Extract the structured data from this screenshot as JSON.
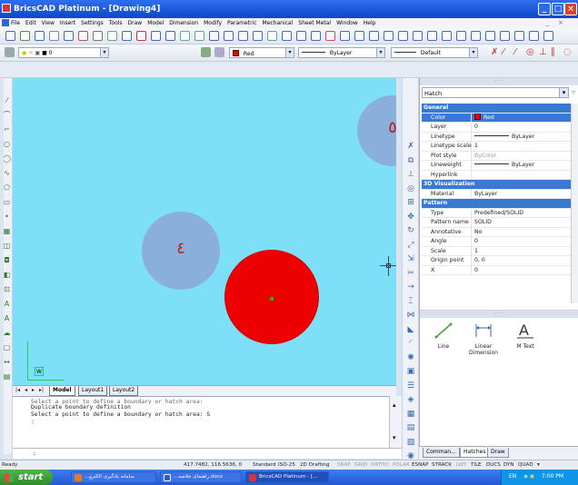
{
  "window": {
    "title": "BricsCAD Platinum - [Drawing4]",
    "btn_min": "_",
    "btn_max": "□",
    "btn_close": "×"
  },
  "menu": [
    "File",
    "Edit",
    "View",
    "Insert",
    "Settings",
    "Tools",
    "Draw",
    "Model",
    "Dimension",
    "Modify",
    "Parametric",
    "Mechanical",
    "Sheet Metal",
    "Window",
    "Help"
  ],
  "layer_toolbar": {
    "layer_value": "0",
    "color_value": "Red",
    "linetype_value": "ByLayer",
    "lineweight_value": "Default"
  },
  "viewport": {
    "annotation_1": "٥",
    "annotation_2": "٤",
    "ucs_label": "W"
  },
  "layout_tabs": [
    "Model",
    "Layout1",
    "Layout2"
  ],
  "command": {
    "lines": [
      "Select a point to define a boundary or hatch area:",
      "Duplicate boundary definition",
      "Select a point to define a boundary or hatch area: S",
      ":"
    ],
    "prompt": ":"
  },
  "properties": {
    "selector": "Hatch",
    "rows": [
      {
        "type": "cat",
        "label": "General"
      },
      {
        "type": "row",
        "key": "Color",
        "value": "Red",
        "hl": true,
        "swatch": true
      },
      {
        "type": "row",
        "key": "Layer",
        "value": "0"
      },
      {
        "type": "row",
        "key": "Linetype",
        "value": "ByLayer",
        "line": true
      },
      {
        "type": "row",
        "key": "Linetype scale",
        "value": "1"
      },
      {
        "type": "row",
        "key": "Plot style",
        "value": "ByColor",
        "dis": true
      },
      {
        "type": "row",
        "key": "Lineweight",
        "value": "ByLayer",
        "line": true
      },
      {
        "type": "row",
        "key": "Hyperlink",
        "value": ""
      },
      {
        "type": "cat",
        "label": "3D Visualization"
      },
      {
        "type": "row",
        "key": "Material",
        "value": "ByLayer"
      },
      {
        "type": "cat",
        "label": "Pattern"
      },
      {
        "type": "row",
        "key": "Type",
        "value": "Predefined/SOLID"
      },
      {
        "type": "row",
        "key": "Pattern name",
        "value": "SOLID"
      },
      {
        "type": "row",
        "key": "Annotative",
        "value": "No"
      },
      {
        "type": "row",
        "key": "Angle",
        "value": "0"
      },
      {
        "type": "row",
        "key": "Scale",
        "value": "1"
      },
      {
        "type": "row",
        "key": "Origin point",
        "value": "0, 0"
      },
      {
        "type": "row",
        "key": "X",
        "value": "0"
      }
    ]
  },
  "palette": {
    "tools": [
      {
        "label": "Line"
      },
      {
        "label": "Linear Dimension"
      },
      {
        "label": "M Text"
      }
    ],
    "tabs": [
      "Comman...",
      "Hatches",
      "Draw"
    ]
  },
  "status": {
    "coords": "417.7482, 116.5636, 0",
    "items_on": [
      "Standard",
      "ISO-25",
      "2D Drafting"
    ],
    "items_off": [
      "SNAP",
      "GRID",
      "ORTHO",
      "POLAR"
    ],
    "items_on2": [
      "ESNAP",
      "STRACK"
    ],
    "items_off2": [
      "LWT"
    ],
    "items_on3": [
      "TILE",
      "DUCS",
      "DYN",
      "QUAD"
    ],
    "ready": "Ready"
  },
  "taskbar": {
    "start": "start",
    "tasks": [
      {
        "label": "...سامانه یادگیری الکترو",
        "color": "#e87b1e"
      },
      {
        "label": "...راهنمای خلاصه.docx",
        "color": "#2b5fc7"
      },
      {
        "label": "BricsCAD Platinum - [...",
        "color": "#d33"
      }
    ],
    "tray_lang": "EN",
    "clock": "7:00 PM"
  },
  "colors": {
    "viewport_bg": "#7ee0f8",
    "hatch": "#ee0000",
    "selection": "#3a78d4"
  }
}
